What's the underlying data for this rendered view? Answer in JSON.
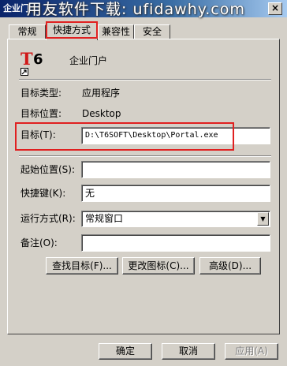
{
  "window": {
    "title": "企业门",
    "watermark": "用友软件下载: ufidawhy.com",
    "close_glyph": "×"
  },
  "tabs": [
    {
      "label": "常规",
      "active": false
    },
    {
      "label": "快捷方式",
      "active": true
    },
    {
      "label": "兼容性",
      "active": false
    },
    {
      "label": "安全",
      "active": false
    }
  ],
  "shortcut": {
    "icon_text_red": "T",
    "icon_text_black": "6",
    "name": "企业门户",
    "target_type_label": "目标类型:",
    "target_type": "应用程序",
    "target_location_label": "目标位置:",
    "target_location": "Desktop",
    "target_label": "目标(T):",
    "target": "D:\\T6SOFT\\Desktop\\Portal.exe",
    "start_in_label": "起始位置(S):",
    "start_in": "",
    "shortcut_key_label": "快捷键(K):",
    "shortcut_key": "无",
    "run_label": "运行方式(R):",
    "run": "常规窗口",
    "comment_label": "备注(O):",
    "comment": ""
  },
  "buttons": {
    "find_target": "查找目标(F)...",
    "change_icon": "更改图标(C)...",
    "advanced": "高级(D)...",
    "ok": "确定",
    "cancel": "取消",
    "apply": "应用(A)"
  },
  "colors": {
    "dialog_bg": "#d4d0c8",
    "title_gradient_start": "#0a246a",
    "highlight_red": "#e02020"
  }
}
